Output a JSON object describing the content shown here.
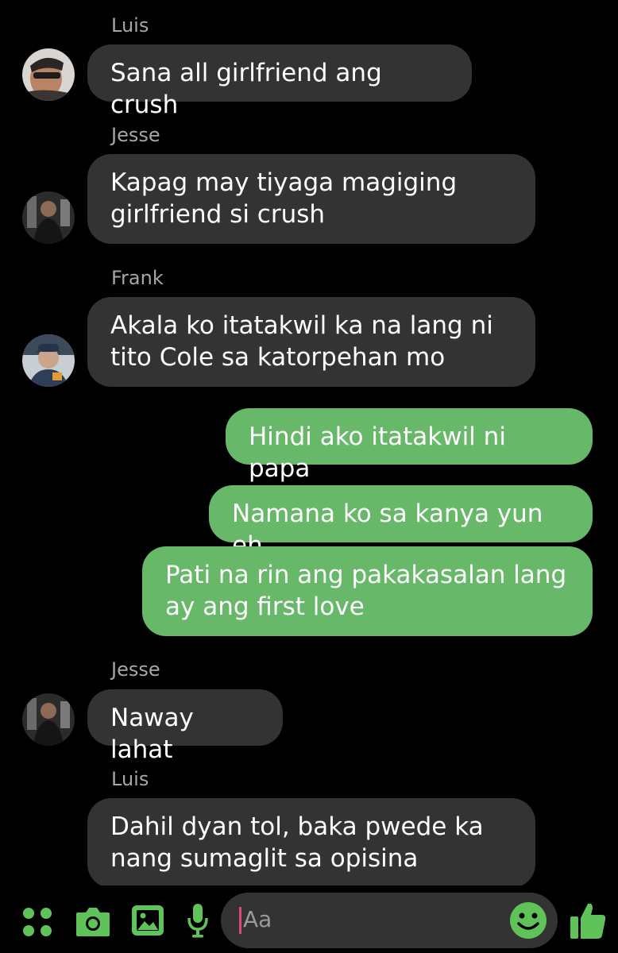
{
  "messages": [
    {
      "sender": "Luis",
      "text": "Sana all girlfriend ang crush",
      "direction": "incoming"
    },
    {
      "sender": "Jesse",
      "text": "Kapag may tiyaga magiging\ngirlfriend si crush",
      "direction": "incoming"
    },
    {
      "sender": "Frank",
      "text": "Akala ko itatakwil ka na lang ni\ntito Cole sa katorpehan mo",
      "direction": "incoming"
    },
    {
      "text": "Hindi ako itatakwil ni papa",
      "direction": "outgoing"
    },
    {
      "text": "Namana ko sa kanya yun eh",
      "direction": "outgoing"
    },
    {
      "text": "Pati na rin ang pakakasalan lang\nay ang first love",
      "direction": "outgoing"
    },
    {
      "sender": "Jesse",
      "text": "Naway lahat",
      "direction": "incoming"
    },
    {
      "sender": "Luis",
      "text": "Dahil dyan tol, baka pwede ka\nnang sumaglit sa opisina",
      "direction": "incoming"
    }
  ],
  "composer": {
    "placeholder": "Aa",
    "icons": [
      "apps-grid-icon",
      "camera-icon",
      "gallery-icon",
      "microphone-icon",
      "emoji-icon",
      "thumbs-up-icon"
    ]
  },
  "colors": {
    "background": "#000000",
    "incoming_bubble": "#333333",
    "outgoing_bubble": "#67b869",
    "accent": "#5fc35a",
    "caret": "#e0457b"
  }
}
